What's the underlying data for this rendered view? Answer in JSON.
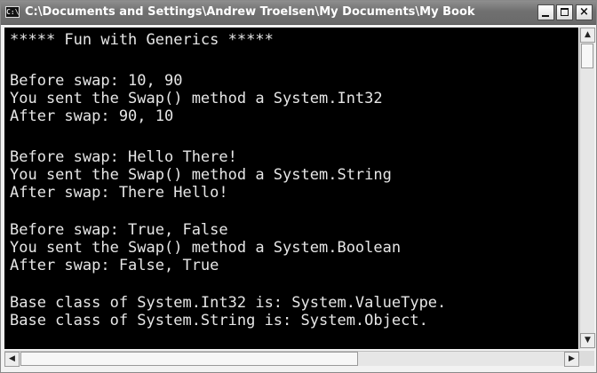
{
  "window": {
    "title": "C:\\Documents and Settings\\Andrew Troelsen\\My Documents\\My Book",
    "system_icon_text": "C:\\",
    "buttons": {
      "minimize": "_",
      "maximize": "□",
      "close": "×"
    }
  },
  "console": {
    "lines": [
      "***** Fun with Generics *****",
      "",
      "Before swap: 10, 90",
      "You sent the Swap() method a System.Int32",
      "After swap: 90, 10",
      "",
      "Before swap: Hello There!",
      "You sent the Swap() method a System.String",
      "After swap: There Hello!",
      "",
      "Before swap: True, False",
      "You sent the Swap() method a System.Boolean",
      "After swap: False, True",
      "",
      "Base class of System.Int32 is: System.ValueType.",
      "Base class of System.String is: System.Object."
    ],
    "colors": {
      "background": "#000000",
      "text": "#e6e6e6"
    }
  },
  "scrollbars": {
    "up_arrow": "▲",
    "down_arrow": "▼",
    "left_arrow": "◀",
    "right_arrow": "▶"
  }
}
